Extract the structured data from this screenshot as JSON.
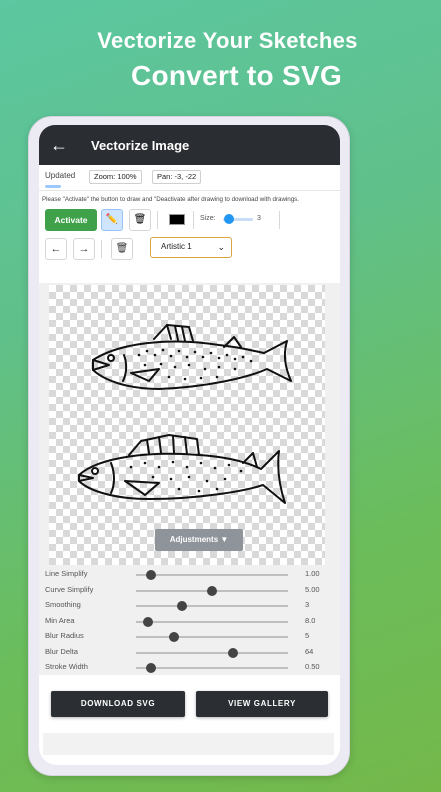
{
  "promo": {
    "headline_1": "Vectorize Your Sketches",
    "headline_2": "Convert to SVG"
  },
  "appbar": {
    "back_icon": "arrow-left-icon",
    "title": "Vectorize Image"
  },
  "status": {
    "updated": "Updated",
    "zoom": "Zoom: 100%",
    "pan": "Pan: -3, -22"
  },
  "hint": "Please \"Activate\" the button to draw and \"Deactivate after drawing to download with drawings.",
  "toolbar": {
    "activate_label": "Activate",
    "pencil_icon": "pencil-icon",
    "eraser_icon": "eraser-icon",
    "stroke_color": "#000000",
    "size_label": "Size:",
    "size_value": "3",
    "size_fraction": 0.1,
    "undo_icon": "arrow-left-icon",
    "redo_icon": "arrow-right-icon",
    "trash_icon": "trash-icon",
    "style_selected": "Artistic 1"
  },
  "adjustments_label": "Adjustments ▼",
  "params": [
    {
      "label": "Line Simplify",
      "value": "1.00",
      "fraction": 0.1
    },
    {
      "label": "Curve Simplify",
      "value": "5.00",
      "fraction": 0.5
    },
    {
      "label": "Smoothing",
      "value": "3",
      "fraction": 0.3
    },
    {
      "label": "Min Area",
      "value": "8.0",
      "fraction": 0.08
    },
    {
      "label": "Blur Radius",
      "value": "5",
      "fraction": 0.25
    },
    {
      "label": "Blur Delta",
      "value": "64",
      "fraction": 0.64
    },
    {
      "label": "Stroke Width",
      "value": "0.50",
      "fraction": 0.1
    }
  ],
  "footer": {
    "download_label": "DOWNLOAD SVG",
    "gallery_label": "VIEW GALLERY"
  },
  "colors": {
    "accent_green": "#3fa24a",
    "appbar": "#2a2d32",
    "select_border": "#d9a642",
    "slider_blue": "#2196f3"
  }
}
